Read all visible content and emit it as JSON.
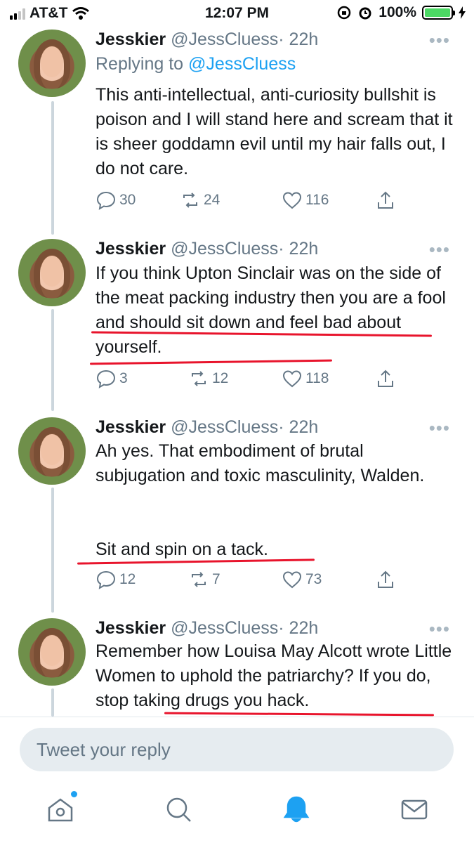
{
  "status_bar": {
    "carrier": "AT&T",
    "time": "12:07 PM",
    "battery": "100%"
  },
  "tweets": [
    {
      "name": "Jesskier",
      "handle": "@JessCluess",
      "time": "· 22h",
      "replying_label": "Replying to",
      "replying_to": "@JessCluess",
      "text": "This anti-intellectual, anti-curiosity bullshit is poison and I will stand here and scream that it is sheer goddamn evil until my hair falls out, I do not care.",
      "replies": "30",
      "retweets": "24",
      "likes": "116"
    },
    {
      "name": "Jesskier",
      "handle": "@JessCluess",
      "time": "· 22h",
      "text": "If you think Upton Sinclair was on the side of the meat packing industry then you are a fool and should sit down and feel bad about yourself.",
      "replies": "3",
      "retweets": "12",
      "likes": "118"
    },
    {
      "name": "Jesskier",
      "handle": "@JessCluess",
      "time": "· 22h",
      "text": "Ah yes. That embodiment of brutal subjugation and toxic masculinity, Walden.",
      "text2": "Sit and spin on a tack.",
      "replies": "12",
      "retweets": "7",
      "likes": "73"
    },
    {
      "name": "Jesskier",
      "handle": "@JessCluess",
      "time": "· 22h",
      "text": "Remember how Louisa May Alcott wrote Little Women to uphold the patriarchy? If you do, stop taking drugs you hack."
    }
  ],
  "more_label": "•••",
  "reply_box": {
    "placeholder": "Tweet your reply"
  },
  "tabs": [
    "home",
    "search",
    "notifications",
    "messages"
  ],
  "colors": {
    "accent": "#1da1f2",
    "muted": "#657786",
    "underline": "#e8142c",
    "battery": "#4cd964"
  }
}
